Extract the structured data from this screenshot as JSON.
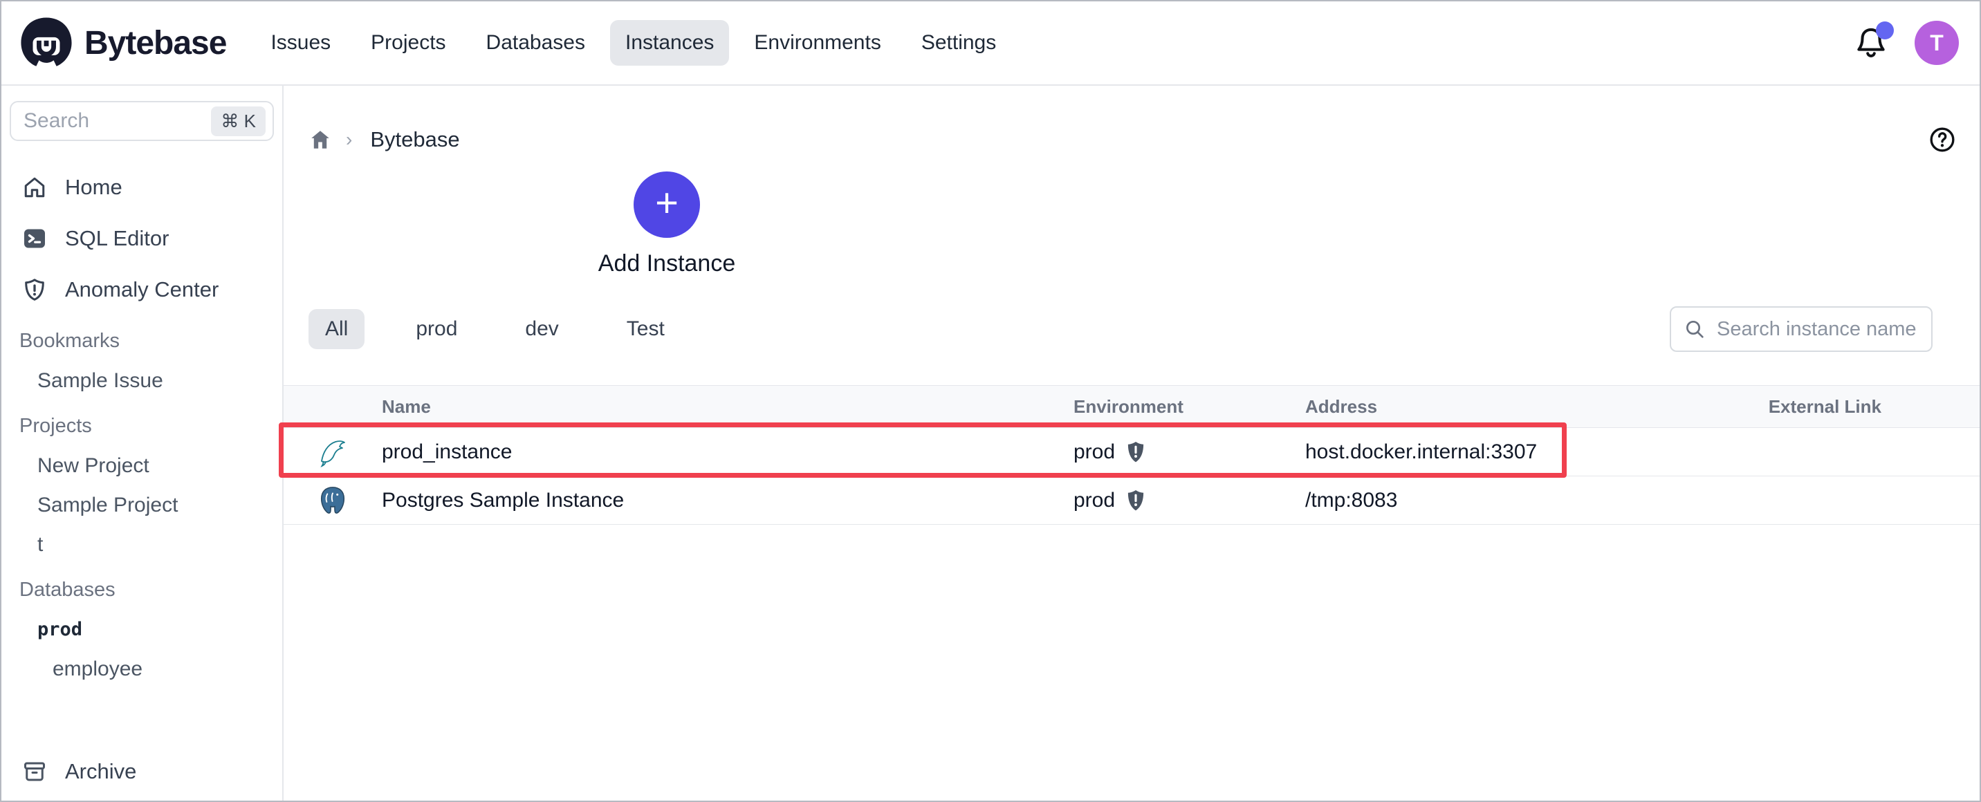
{
  "nav": {
    "brand": "Bytebase",
    "items": [
      "Issues",
      "Projects",
      "Databases",
      "Instances",
      "Environments",
      "Settings"
    ],
    "active_item": "Instances",
    "avatar_letter": "T"
  },
  "sidebar": {
    "search_placeholder": "Search",
    "search_shortcut": "⌘ K",
    "items": [
      {
        "label": "Home",
        "icon": "home-icon"
      },
      {
        "label": "SQL Editor",
        "icon": "terminal-icon"
      },
      {
        "label": "Anomaly Center",
        "icon": "shield-alert-icon"
      }
    ],
    "sections": [
      {
        "title": "Bookmarks",
        "items": [
          "Sample Issue"
        ]
      },
      {
        "title": "Projects",
        "items": [
          "New Project",
          "Sample Project",
          "t"
        ]
      },
      {
        "title": "Databases",
        "items": [
          "prod",
          "employee"
        ]
      }
    ],
    "archive_label": "Archive"
  },
  "breadcrumb": {
    "root": "Bytebase"
  },
  "main": {
    "add_instance_label": "Add Instance",
    "add_instance_plus": "+",
    "tabs": [
      "All",
      "prod",
      "dev",
      "Test"
    ],
    "active_tab": "All",
    "instance_search_placeholder": "Search instance name"
  },
  "table": {
    "columns": [
      "Name",
      "Environment",
      "Address",
      "External Link"
    ],
    "rows": [
      {
        "engine": "mysql",
        "name": "prod_instance",
        "environment": "prod",
        "address": "host.docker.internal:3307",
        "external_link": "",
        "highlighted": true
      },
      {
        "engine": "postgres",
        "name": "Postgres Sample Instance",
        "environment": "prod",
        "address": "/tmp:8083",
        "external_link": "",
        "highlighted": false
      }
    ]
  },
  "colors": {
    "accent": "#5046e5",
    "avatar": "#b661de",
    "notification_dot": "#6366f1",
    "highlight_red": "#f0404e",
    "active_bg": "#e5e7eb",
    "mysql_teal": "#1b7e8f",
    "postgres_blue": "#336791"
  }
}
